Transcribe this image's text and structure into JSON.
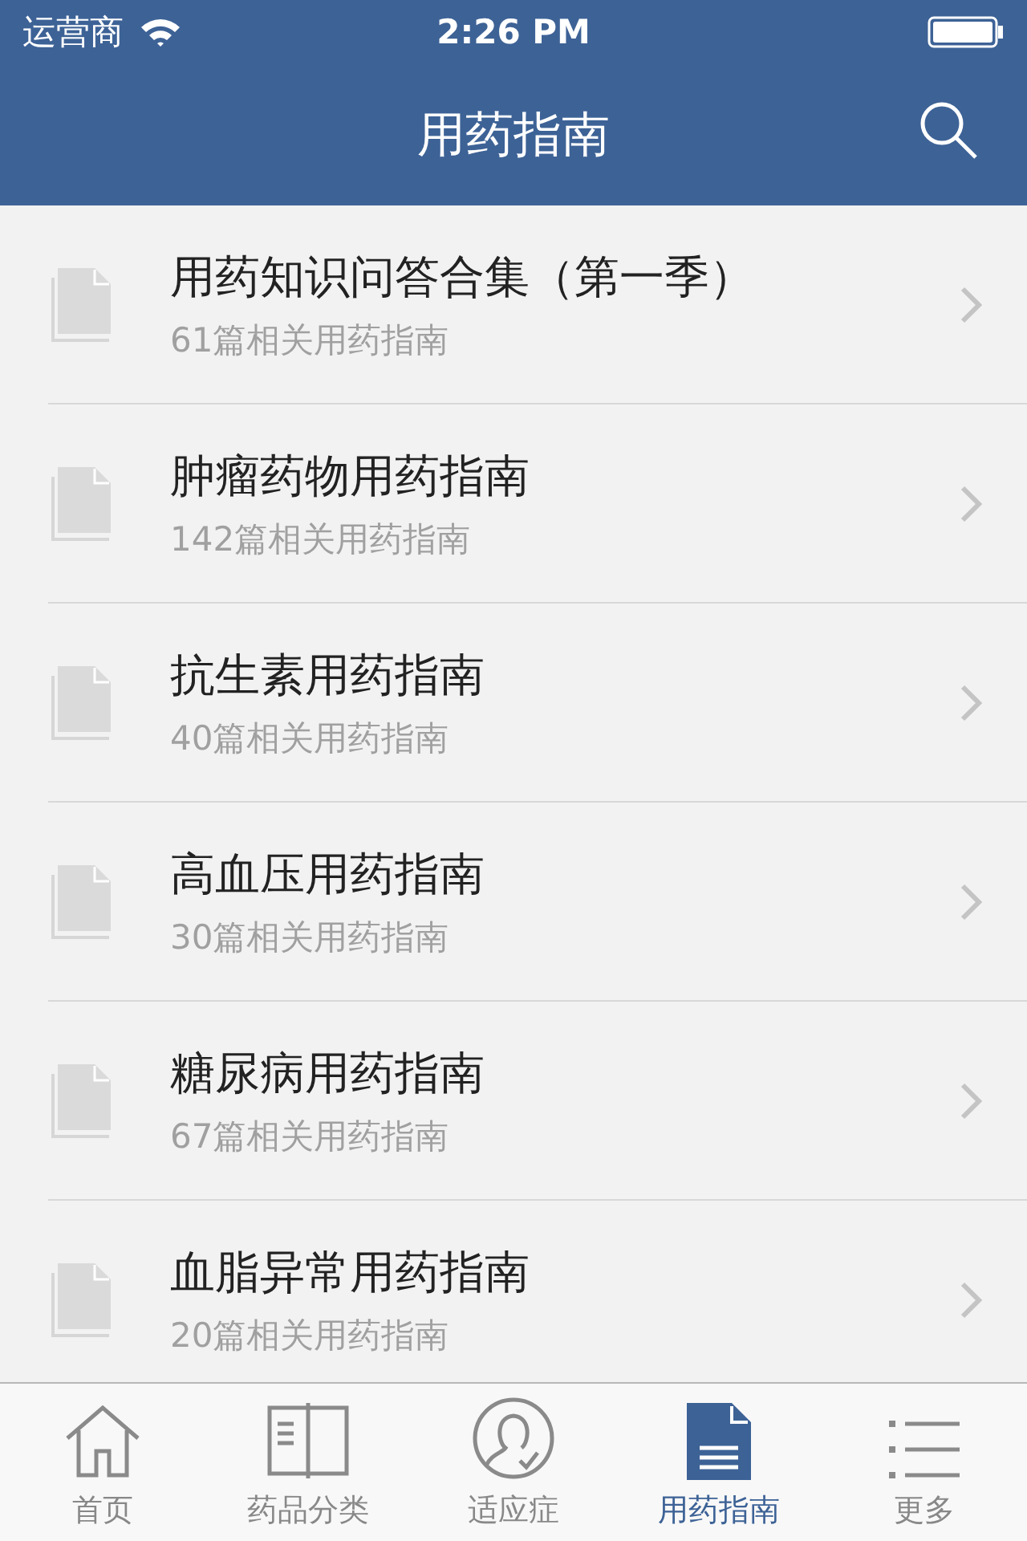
{
  "status_bar": {
    "carrier": "运营商",
    "time": "2:26 PM"
  },
  "nav_bar": {
    "title": "用药指南"
  },
  "guides": [
    {
      "title": "用药知识问答合集（第一季）",
      "subtitle": "61篇相关用药指南"
    },
    {
      "title": "肿瘤药物用药指南",
      "subtitle": "142篇相关用药指南"
    },
    {
      "title": "抗生素用药指南",
      "subtitle": "40篇相关用药指南"
    },
    {
      "title": "高血压用药指南",
      "subtitle": "30篇相关用药指南"
    },
    {
      "title": "糖尿病用药指南",
      "subtitle": "67篇相关用药指南"
    },
    {
      "title": "血脂异常用药指南",
      "subtitle": "20篇相关用药指南"
    }
  ],
  "tab_bar": [
    {
      "kind": "home",
      "label": "首页",
      "selected": false
    },
    {
      "kind": "book",
      "label": "药品分类",
      "selected": false
    },
    {
      "kind": "person",
      "label": "适应症",
      "selected": false
    },
    {
      "kind": "document",
      "label": "用药指南",
      "selected": true
    },
    {
      "kind": "list",
      "label": "更多",
      "selected": false
    }
  ]
}
